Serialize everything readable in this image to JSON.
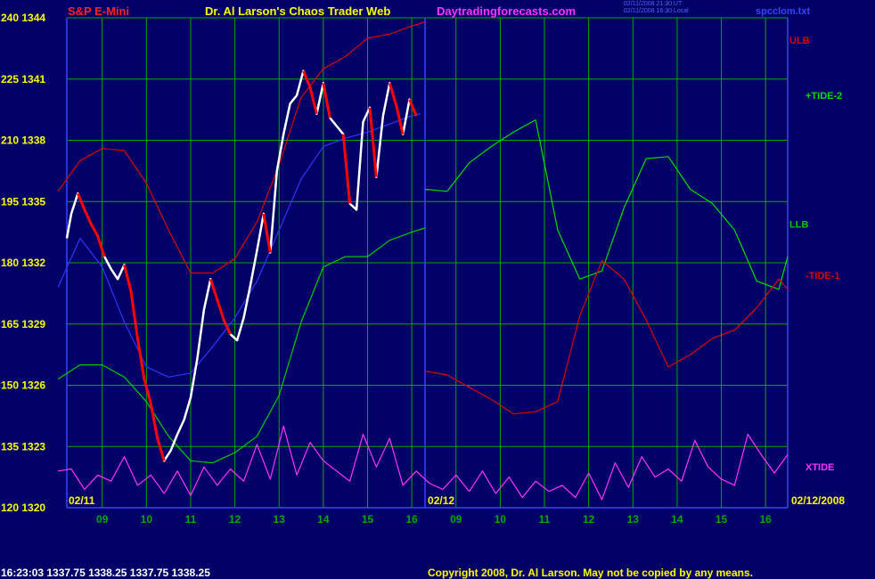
{
  "header": {
    "instrument": "S&P E-Mini",
    "site_title": "Dr. Al Larson's Chaos Trader Web",
    "site_url": "Daytradingforecasts.com",
    "timestamp_ut": "02/11/2008 21:30 UT",
    "timestamp_local": "02/11/2008 16:30 Local",
    "file_name": "spcclom.txt"
  },
  "footer": {
    "quote": "16:23:03  1337.75 1338.25 1337.75 1338.25",
    "copyright": "Copyright 2008, Dr. Al Larson. May not be copied by any means."
  },
  "colors": {
    "background": "#000066",
    "grid": "#00aa00",
    "price": "#ffffff",
    "price_down": "#ff0000",
    "ulb": "#dd0000",
    "llb": "#00cc00",
    "tide_plus": "#00dd00",
    "tide_minus": "#dd0000",
    "xtide": "#ff33ff",
    "moving_avg": "#3333ff",
    "yellow": "#ffff00"
  },
  "chart_data": {
    "type": "line",
    "title": "S&P E-Mini",
    "y_left_ticks": [
      "240",
      "225",
      "210",
      "195",
      "180",
      "165",
      "150",
      "135",
      "120"
    ],
    "y_right_ticks": [
      "1344",
      "1341",
      "1338",
      "1335",
      "1332",
      "1329",
      "1326",
      "1323",
      "1320"
    ],
    "ylim": [
      1320,
      1344
    ],
    "x_ticks": [
      "09",
      "10",
      "11",
      "12",
      "13",
      "14",
      "15",
      "16",
      "09",
      "10",
      "11",
      "12",
      "13",
      "14",
      "15",
      "16"
    ],
    "dates": [
      "02/11",
      "02/12",
      "02/12/2008"
    ],
    "legend": [
      "ULB",
      "+TIDE-2",
      "LLB",
      "-TIDE-1",
      "XTIDE"
    ],
    "series": [
      {
        "name": "Price",
        "x": [
          8.2,
          8.3,
          8.45,
          8.6,
          8.75,
          8.9,
          9.05,
          9.2,
          9.35,
          9.5,
          9.65,
          9.8,
          9.95,
          10.1,
          10.25,
          10.4,
          10.55,
          10.7,
          10.85,
          11.0,
          11.15,
          11.3,
          11.45,
          11.6,
          11.75,
          11.9,
          12.05,
          12.2,
          12.35,
          12.5,
          12.65,
          12.8,
          12.95,
          13.1,
          13.25,
          13.4,
          13.55,
          13.7,
          13.85,
          14.0,
          14.15,
          14.3,
          14.45,
          14.6,
          14.75,
          14.9,
          15.05,
          15.2,
          15.35,
          15.5,
          15.65,
          15.8,
          15.95,
          16.1
        ],
        "y": [
          1333.2,
          1334.4,
          1335.4,
          1334.6,
          1333.9,
          1333.3,
          1332.3,
          1331.7,
          1331.2,
          1331.9,
          1330.6,
          1328.3,
          1326.3,
          1325.1,
          1323.4,
          1322.3,
          1322.8,
          1323.6,
          1324.3,
          1325.4,
          1327.3,
          1329.7,
          1331.2,
          1330.2,
          1329.2,
          1328.5,
          1328.2,
          1329.3,
          1330.9,
          1332.6,
          1334.4,
          1332.5,
          1336.5,
          1338.3,
          1339.8,
          1340.2,
          1341.4,
          1340.6,
          1339.3,
          1340.8,
          1339.1,
          1338.7,
          1338.3,
          1334.9,
          1334.6,
          1338.9,
          1339.6,
          1336.2,
          1339.2,
          1340.8,
          1339.7,
          1338.3,
          1340.0,
          1339.2
        ]
      },
      {
        "name": "ULB",
        "x": [
          8.0,
          8.5,
          9.0,
          9.5,
          10.0,
          10.5,
          11.0,
          11.5,
          12.0,
          12.5,
          13.0,
          13.5,
          14.0,
          14.5,
          15.0,
          15.5,
          16.0,
          16.3
        ],
        "y": [
          1335.5,
          1337.0,
          1337.6,
          1337.5,
          1335.9,
          1333.6,
          1331.5,
          1331.5,
          1332.2,
          1334.0,
          1336.8,
          1340.1,
          1341.5,
          1342.1,
          1343.0,
          1343.2,
          1343.6,
          1343.8
        ]
      },
      {
        "name": "LLB",
        "x": [
          8.0,
          8.5,
          9.0,
          9.5,
          10.0,
          10.5,
          11.0,
          11.5,
          12.0,
          12.5,
          13.0,
          13.5,
          14.0,
          14.5,
          15.0,
          15.5,
          16.0,
          16.3
        ],
        "y": [
          1326.3,
          1327.0,
          1327.0,
          1326.4,
          1325.2,
          1323.5,
          1322.3,
          1322.2,
          1322.7,
          1323.5,
          1325.5,
          1329.1,
          1331.8,
          1332.3,
          1332.3,
          1333.1,
          1333.5,
          1333.7
        ]
      },
      {
        "name": "+TIDE-2",
        "x": [
          16.3,
          16.8,
          17.3,
          17.8,
          18.3,
          18.8,
          19.3,
          19.8,
          20.3,
          20.8,
          21.3,
          21.8,
          22.3,
          22.8,
          23.3,
          23.8,
          24.3,
          24.5
        ],
        "y": [
          1335.6,
          1335.5,
          1336.9,
          1337.7,
          1338.4,
          1339.0,
          1333.6,
          1331.2,
          1331.6,
          1334.7,
          1337.1,
          1337.2,
          1335.6,
          1334.9,
          1333.6,
          1331.1,
          1330.7,
          1332.3
        ]
      },
      {
        "name": "-TIDE-1",
        "x": [
          16.3,
          16.8,
          17.3,
          17.8,
          18.3,
          18.8,
          19.3,
          19.8,
          20.3,
          20.8,
          21.3,
          21.8,
          22.3,
          22.8,
          23.3,
          23.8,
          24.3,
          24.5
        ],
        "y": [
          1326.7,
          1326.5,
          1325.9,
          1325.3,
          1324.6,
          1324.7,
          1325.2,
          1329.4,
          1332.1,
          1331.2,
          1329.2,
          1326.9,
          1327.5,
          1328.3,
          1328.7,
          1329.8,
          1331.2,
          1330.7
        ]
      },
      {
        "name": "XTIDE",
        "x": [
          8.0,
          8.3,
          8.6,
          8.9,
          9.2,
          9.5,
          9.8,
          10.1,
          10.4,
          10.7,
          11.0,
          11.3,
          11.6,
          11.9,
          12.2,
          12.5,
          12.8,
          13.1,
          13.4,
          13.7,
          14.0,
          14.3,
          14.6,
          14.9,
          15.2,
          15.5,
          15.8,
          16.1,
          16.4,
          16.7,
          17.0,
          17.3,
          17.6,
          17.9,
          18.2,
          18.5,
          18.8,
          19.1,
          19.4,
          19.7,
          20.0,
          20.3,
          20.6,
          20.9,
          21.2,
          21.5,
          21.8,
          22.1,
          22.4,
          22.7,
          23.0,
          23.3,
          23.6,
          23.9,
          24.2,
          24.5
        ],
        "y": [
          1321.8,
          1321.9,
          1320.9,
          1321.6,
          1321.3,
          1322.5,
          1321.1,
          1321.6,
          1320.7,
          1321.8,
          1320.6,
          1322.0,
          1321.1,
          1321.9,
          1321.3,
          1323.1,
          1321.4,
          1324.0,
          1321.6,
          1323.2,
          1322.3,
          1321.8,
          1321.3,
          1323.6,
          1322.0,
          1323.4,
          1321.1,
          1321.8,
          1321.2,
          1320.9,
          1321.6,
          1320.8,
          1321.8,
          1320.7,
          1321.5,
          1320.5,
          1321.3,
          1320.8,
          1321.1,
          1320.5,
          1321.7,
          1320.4,
          1322.2,
          1321.0,
          1322.5,
          1321.5,
          1321.9,
          1321.3,
          1323.3,
          1322.0,
          1321.4,
          1321.1,
          1323.6,
          1322.6,
          1321.7,
          1322.6
        ]
      },
      {
        "name": "Moving average",
        "x": [
          8.0,
          8.5,
          9.0,
          9.5,
          10.0,
          10.5,
          11.0,
          11.5,
          12.0,
          12.5,
          13.0,
          13.5,
          14.0,
          14.5,
          15.0,
          15.5,
          16.0,
          16.2
        ],
        "y": [
          1330.8,
          1333.2,
          1331.8,
          1329.1,
          1326.9,
          1326.4,
          1326.6,
          1327.9,
          1329.3,
          1331.1,
          1333.6,
          1336.1,
          1337.7,
          1338.1,
          1338.4,
          1338.8,
          1339.2,
          1339.3
        ]
      }
    ]
  }
}
